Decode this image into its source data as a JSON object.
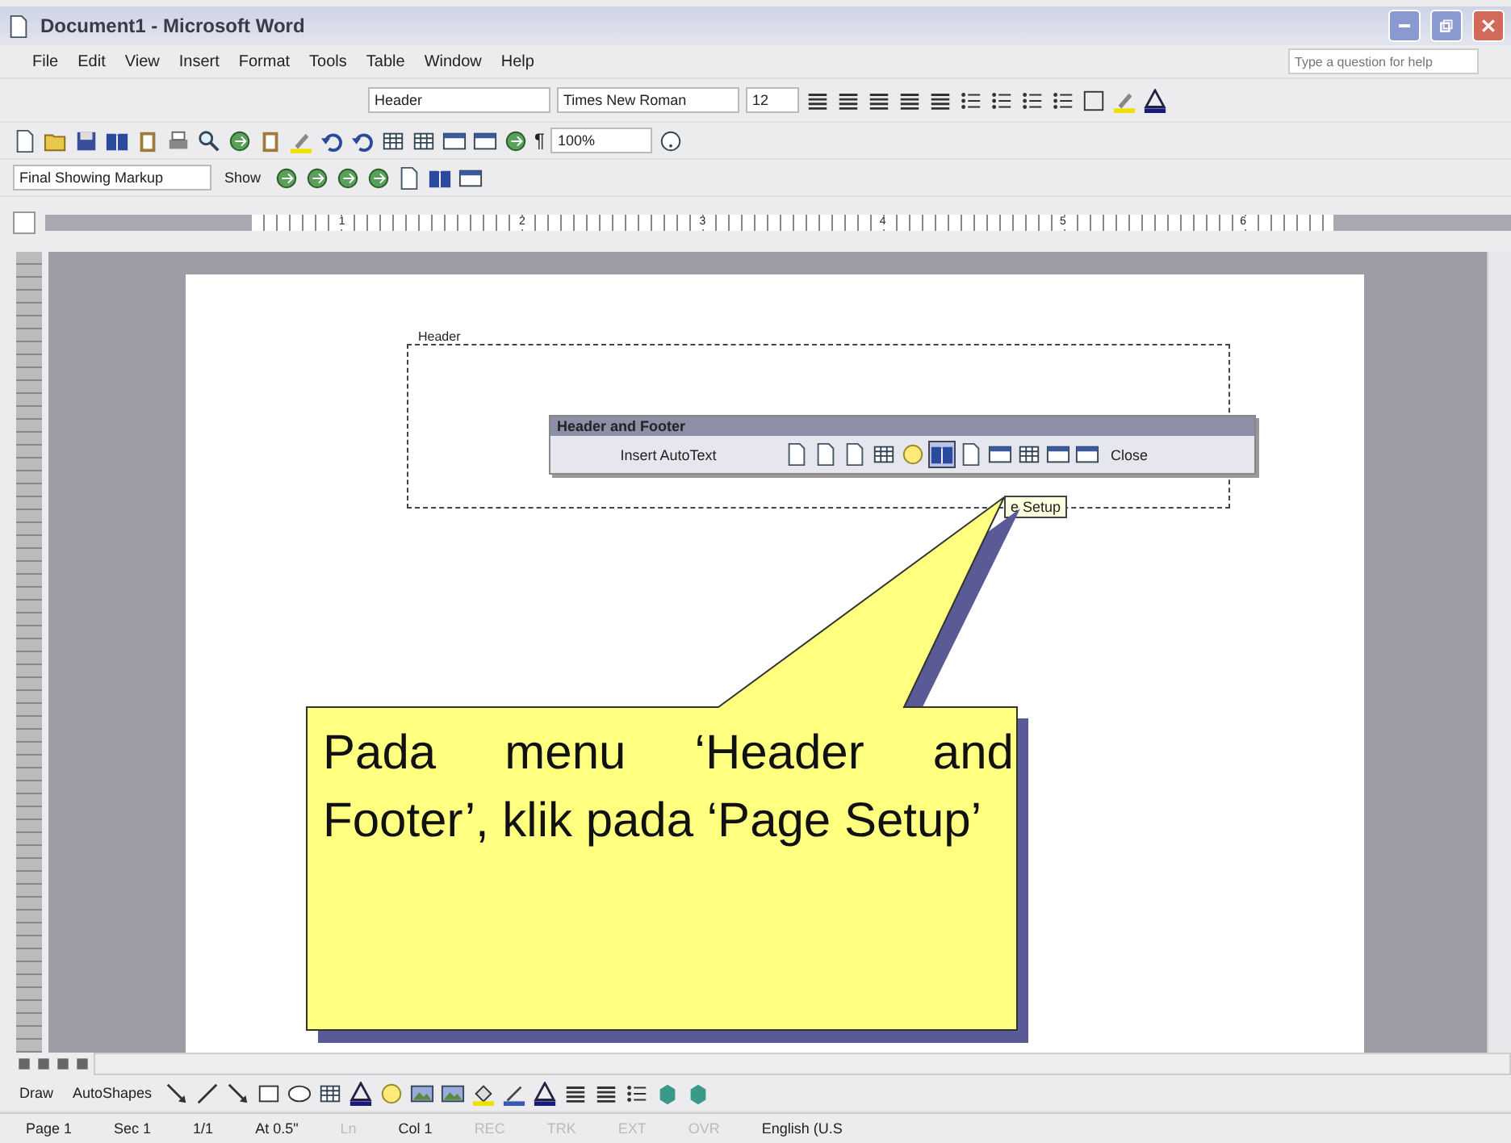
{
  "window": {
    "title": "Document1 - Microsoft Word"
  },
  "menu": [
    "File",
    "Edit",
    "View",
    "Insert",
    "Format",
    "Tools",
    "Table",
    "Window",
    "Help"
  ],
  "help_box": {
    "placeholder": "Type a question for help"
  },
  "formatting_toolbar": {
    "style": "Header",
    "font": "Times New Roman",
    "size": "12"
  },
  "standard_toolbar": {
    "zoom": "100%",
    "pilcrow": "¶"
  },
  "reviewing_toolbar": {
    "display": "Final Showing Markup",
    "show": "Show"
  },
  "ruler": {
    "marks": [
      "1",
      "2",
      "3",
      "4",
      "5",
      "6"
    ]
  },
  "document": {
    "header_label": "Header"
  },
  "header_footer_toolbar": {
    "title": "Header and Footer",
    "insert_autotext": "Insert AutoText",
    "close": "Close"
  },
  "tooltip": "e Setup",
  "callout": {
    "text": "Pada menu ‘Header and Footer’, klik pada ‘Page Setup’"
  },
  "drawing_toolbar": {
    "draw": "Draw",
    "autoshapes": "AutoShapes"
  },
  "status_bar": [
    {
      "text": "Page 1",
      "disabled": false
    },
    {
      "text": "Sec 1",
      "disabled": false
    },
    {
      "text": "1/1",
      "disabled": false
    },
    {
      "text": "At 0.5\"",
      "disabled": false
    },
    {
      "text": "Ln",
      "disabled": true
    },
    {
      "text": "Col 1",
      "disabled": false
    },
    {
      "text": "REC",
      "disabled": true
    },
    {
      "text": "TRK",
      "disabled": true
    },
    {
      "text": "EXT",
      "disabled": true
    },
    {
      "text": "OVR",
      "disabled": true
    },
    {
      "text": "English (U.S",
      "disabled": false
    }
  ]
}
